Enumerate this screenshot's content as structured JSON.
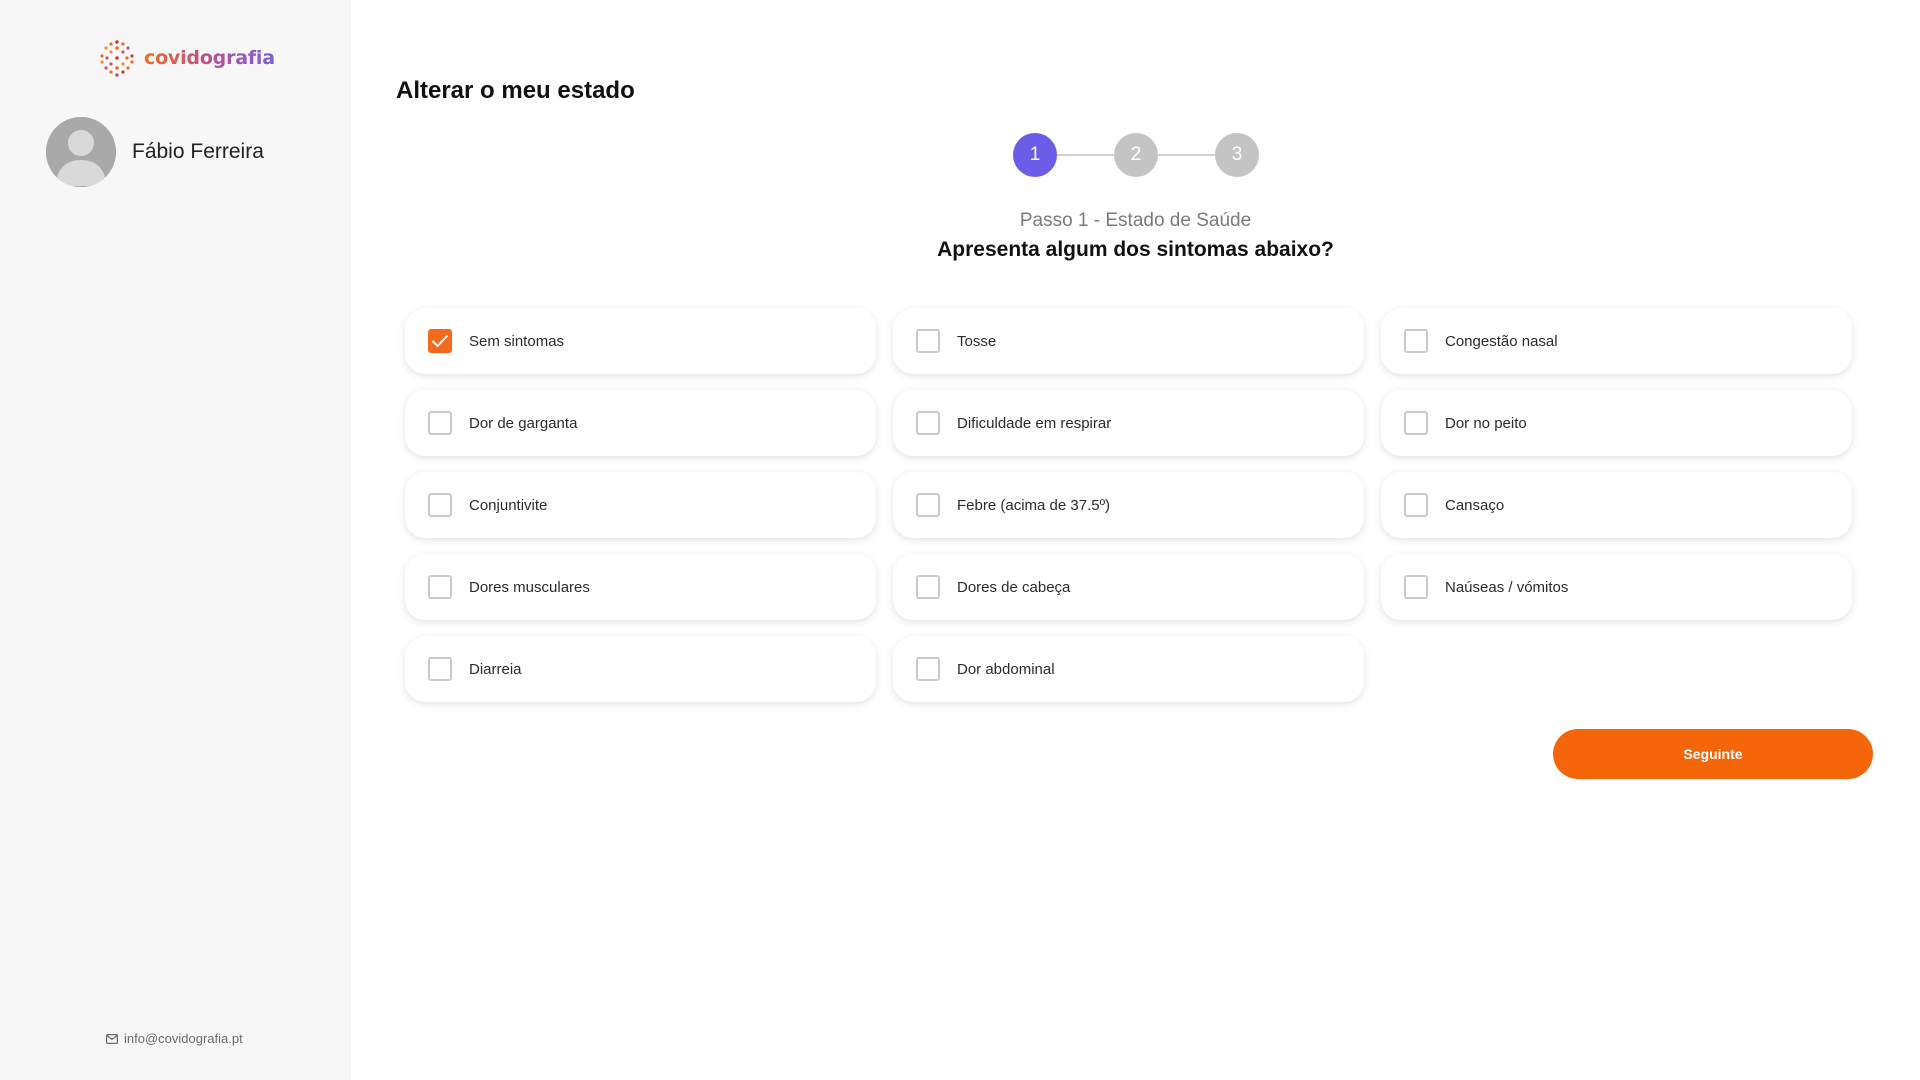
{
  "sidebar": {
    "logo_text": "covidografia",
    "user_name": "Fábio Ferreira",
    "contact_email": "info@covidografia.pt"
  },
  "main": {
    "title": "Alterar o meu estado",
    "stepper": {
      "steps": [
        "1",
        "2",
        "3"
      ],
      "current": 1
    },
    "step_caption": "Passo 1 - Estado de Saúde",
    "question": "Apresenta algum dos sintomas abaixo?",
    "options": [
      {
        "label": "Sem sintomas",
        "checked": true
      },
      {
        "label": "Tosse",
        "checked": false
      },
      {
        "label": "Congestão nasal",
        "checked": false
      },
      {
        "label": "Dor de garganta",
        "checked": false
      },
      {
        "label": "Dificuldade em respirar",
        "checked": false
      },
      {
        "label": "Dor no peito",
        "checked": false
      },
      {
        "label": "Conjuntivite",
        "checked": false
      },
      {
        "label": "Febre (acima de 37.5º)",
        "checked": false
      },
      {
        "label": "Cansaço",
        "checked": false
      },
      {
        "label": "Dores musculares",
        "checked": false
      },
      {
        "label": "Dores de cabeça",
        "checked": false
      },
      {
        "label": "Naúseas / vómitos",
        "checked": false
      },
      {
        "label": "Diarreia",
        "checked": false
      },
      {
        "label": "Dor abdominal",
        "checked": false
      }
    ],
    "next_label": "Seguinte"
  },
  "colors": {
    "accent_orange": "#f56509",
    "step_active": "#6c5ce7",
    "step_inactive": "#c4c4c4",
    "sidebar_bg": "#f7f7f7"
  },
  "icons": {
    "logo": "covidografia-logo-icon",
    "avatar": "user-avatar-icon",
    "mail": "mail-icon",
    "check": "checkmark-icon"
  }
}
